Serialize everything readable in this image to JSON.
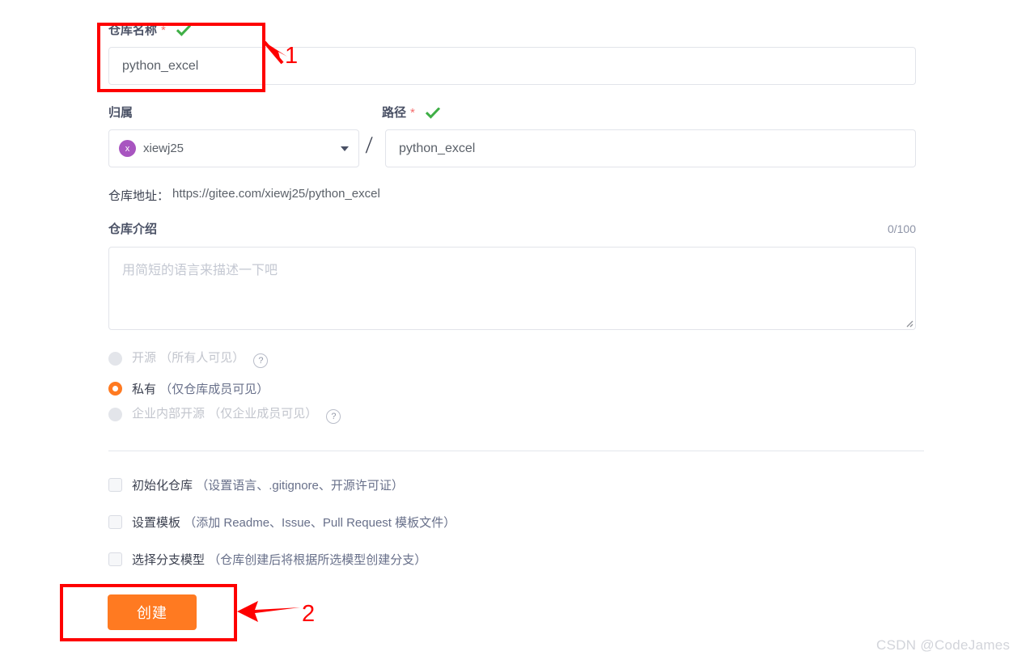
{
  "form": {
    "repo_name": {
      "label": "仓库名称",
      "required_mark": "*",
      "value": "python_excel",
      "valid_icon": "check-icon"
    },
    "owner": {
      "label": "归属",
      "avatar_initial": "x",
      "avatar_color": "#a855c0",
      "selected": "xiewj25",
      "caret_icon": "chevron-down-icon"
    },
    "separator": "/",
    "path": {
      "label": "路径",
      "required_mark": "*",
      "value": "python_excel",
      "valid_icon": "check-icon"
    },
    "repo_address": {
      "label": "仓库地址：",
      "url": "https://gitee.com/xiewj25/python_excel"
    },
    "description": {
      "label": "仓库介绍",
      "counter": "0/100",
      "placeholder": "用简短的语言来描述一下吧",
      "value": ""
    },
    "visibility": {
      "options": [
        {
          "label": "开源",
          "hint": "（所有人可见）",
          "selected": false,
          "disabled": true,
          "help_icon": "question-mark-icon"
        },
        {
          "label": "私有",
          "hint": "（仅仓库成员可见）",
          "selected": true,
          "disabled": false,
          "help_icon": ""
        },
        {
          "label": "企业内部开源",
          "hint": "（仅企业成员可见）",
          "selected": false,
          "disabled": true,
          "help_icon": "question-mark-icon"
        }
      ]
    },
    "checkboxes": [
      {
        "label": "初始化仓库",
        "hint": "（设置语言、.gitignore、开源许可证）",
        "checked": false
      },
      {
        "label": "设置模板",
        "hint": "（添加 Readme、Issue、Pull Request 模板文件）",
        "checked": false
      },
      {
        "label": "选择分支模型",
        "hint": "（仓库创建后将根据所选模型创建分支）",
        "checked": false
      }
    ],
    "submit": {
      "label": "创建",
      "color": "#ff7a21"
    }
  },
  "annotations": {
    "color": "#fe0000",
    "marks": [
      {
        "number": "1",
        "target": "repo-name-field"
      },
      {
        "number": "2",
        "target": "create-button"
      }
    ]
  },
  "watermark": "CSDN @CodeJames"
}
